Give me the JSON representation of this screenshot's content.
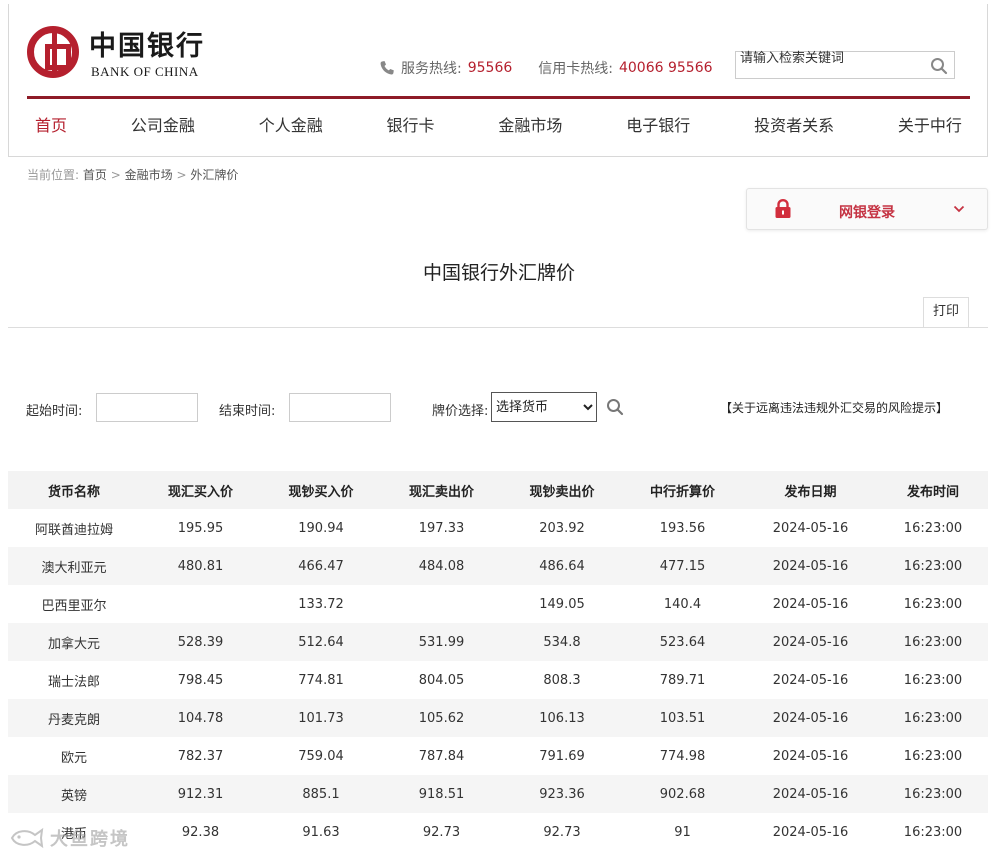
{
  "logo": {
    "cn": "中国银行",
    "en": "BANK OF CHINA",
    "color": "#b5202e"
  },
  "hotline": {
    "service_label": "服务热线:",
    "service_num": "95566",
    "card_label": "信用卡热线:",
    "card_num": "40066 95566"
  },
  "search": {
    "placeholder": "请输入检索关键词"
  },
  "nav": [
    "首页",
    "公司金融",
    "个人金融",
    "银行卡",
    "金融市场",
    "电子银行",
    "投资者关系",
    "关于中行"
  ],
  "breadcrumb": {
    "prefix": "当前位置:",
    "items": [
      "首页",
      "金融市场",
      "外汇牌价"
    ],
    "sep": ">"
  },
  "login": {
    "label": "网银登录"
  },
  "page_title": "中国银行外汇牌价",
  "print_label": "打印",
  "filter": {
    "start_label": "起始时间:",
    "end_label": "结束时间:",
    "currency_label": "牌价选择:",
    "currency_selected": "选择货币",
    "risk_notice": "【关于远离违法违规外汇交易的风险提示】"
  },
  "table": {
    "headers": [
      "货币名称",
      "现汇买入价",
      "现钞买入价",
      "现汇卖出价",
      "现钞卖出价",
      "中行折算价",
      "发布日期",
      "发布时间"
    ],
    "rows": [
      [
        "阿联酋迪拉姆",
        "195.95",
        "190.94",
        "197.33",
        "203.92",
        "193.56",
        "2024-05-16",
        "16:23:00"
      ],
      [
        "澳大利亚元",
        "480.81",
        "466.47",
        "484.08",
        "486.64",
        "477.15",
        "2024-05-16",
        "16:23:00"
      ],
      [
        "巴西里亚尔",
        "",
        "133.72",
        "",
        "149.05",
        "140.4",
        "2024-05-16",
        "16:23:00"
      ],
      [
        "加拿大元",
        "528.39",
        "512.64",
        "531.99",
        "534.8",
        "523.64",
        "2024-05-16",
        "16:23:00"
      ],
      [
        "瑞士法郎",
        "798.45",
        "774.81",
        "804.05",
        "808.3",
        "789.71",
        "2024-05-16",
        "16:23:00"
      ],
      [
        "丹麦克朗",
        "104.78",
        "101.73",
        "105.62",
        "106.13",
        "103.51",
        "2024-05-16",
        "16:23:00"
      ],
      [
        "欧元",
        "782.37",
        "759.04",
        "787.84",
        "791.69",
        "774.98",
        "2024-05-16",
        "16:23:00"
      ],
      [
        "英镑",
        "912.31",
        "885.1",
        "918.51",
        "923.36",
        "902.68",
        "2024-05-16",
        "16:23:00"
      ],
      [
        "港币",
        "92.38",
        "91.63",
        "92.73",
        "92.73",
        "91",
        "2024-05-16",
        "16:23:00"
      ]
    ]
  },
  "watermark": "大鱼跨境"
}
